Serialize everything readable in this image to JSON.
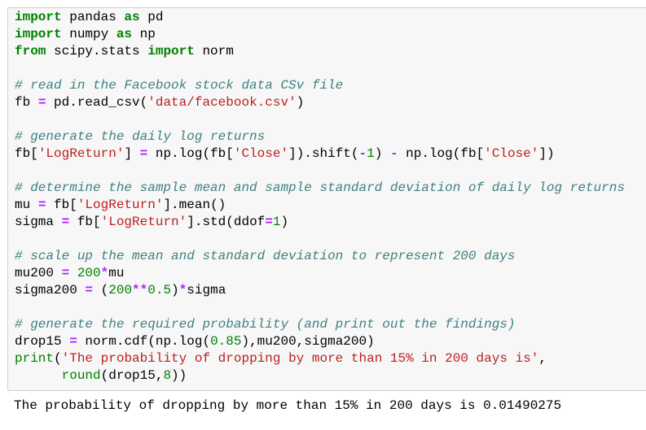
{
  "code_cell": {
    "lines": [
      [
        [
          "k",
          "import"
        ],
        [
          "t",
          " pandas "
        ],
        [
          "k",
          "as"
        ],
        [
          "t",
          " pd"
        ]
      ],
      [
        [
          "k",
          "import"
        ],
        [
          "t",
          " numpy "
        ],
        [
          "k",
          "as"
        ],
        [
          "t",
          " np"
        ]
      ],
      [
        [
          "k",
          "from"
        ],
        [
          "t",
          " scipy.stats "
        ],
        [
          "k",
          "import"
        ],
        [
          "t",
          " norm"
        ]
      ],
      [],
      [
        [
          "c",
          "# read in the Facebook stock data CSv file"
        ]
      ],
      [
        [
          "t",
          "fb "
        ],
        [
          "o",
          "="
        ],
        [
          "t",
          " pd.read_csv("
        ],
        [
          "s",
          "'data/facebook.csv'"
        ],
        [
          "t",
          ")"
        ]
      ],
      [],
      [
        [
          "c",
          "# generate the daily log returns"
        ]
      ],
      [
        [
          "t",
          "fb["
        ],
        [
          "s",
          "'LogReturn'"
        ],
        [
          "t",
          "] "
        ],
        [
          "o",
          "="
        ],
        [
          "t",
          " np.log(fb["
        ],
        [
          "s",
          "'Close'"
        ],
        [
          "t",
          "]).shift("
        ],
        [
          "o",
          "-"
        ],
        [
          "n",
          "1"
        ],
        [
          "t",
          ") "
        ],
        [
          "o",
          "-"
        ],
        [
          "t",
          " np.log(fb["
        ],
        [
          "s",
          "'Close'"
        ],
        [
          "t",
          "])"
        ]
      ],
      [],
      [
        [
          "c",
          "# determine the sample mean and sample standard deviation of daily log returns"
        ]
      ],
      [
        [
          "t",
          "mu "
        ],
        [
          "o",
          "="
        ],
        [
          "t",
          " fb["
        ],
        [
          "s",
          "'LogReturn'"
        ],
        [
          "t",
          "].mean()"
        ]
      ],
      [
        [
          "t",
          "sigma "
        ],
        [
          "o",
          "="
        ],
        [
          "t",
          " fb["
        ],
        [
          "s",
          "'LogReturn'"
        ],
        [
          "t",
          "].std(ddof"
        ],
        [
          "o",
          "="
        ],
        [
          "n",
          "1"
        ],
        [
          "t",
          ")"
        ]
      ],
      [],
      [
        [
          "c",
          "# scale up the mean and standard deviation to represent 200 days"
        ]
      ],
      [
        [
          "t",
          "mu200 "
        ],
        [
          "o",
          "="
        ],
        [
          "t",
          " "
        ],
        [
          "n",
          "200"
        ],
        [
          "o",
          "*"
        ],
        [
          "t",
          "mu"
        ]
      ],
      [
        [
          "t",
          "sigma200 "
        ],
        [
          "o",
          "="
        ],
        [
          "t",
          " ("
        ],
        [
          "n",
          "200"
        ],
        [
          "o",
          "**"
        ],
        [
          "n",
          "0.5"
        ],
        [
          "t",
          ")"
        ],
        [
          "o",
          "*"
        ],
        [
          "t",
          "sigma"
        ]
      ],
      [],
      [
        [
          "c",
          "# generate the required probability (and print out the findings)"
        ]
      ],
      [
        [
          "t",
          "drop15 "
        ],
        [
          "o",
          "="
        ],
        [
          "t",
          " norm.cdf(np.log("
        ],
        [
          "n",
          "0.85"
        ],
        [
          "t",
          "),mu200,sigma200)"
        ]
      ],
      [
        [
          "b",
          "print"
        ],
        [
          "t",
          "("
        ],
        [
          "s",
          "'The probability of dropping by more than 15% in 200 days is'"
        ],
        [
          "t",
          ","
        ]
      ],
      [
        [
          "t",
          "      "
        ],
        [
          "b",
          "round"
        ],
        [
          "t",
          "(drop15,"
        ],
        [
          "n",
          "8"
        ],
        [
          "t",
          "))"
        ]
      ]
    ]
  },
  "output": {
    "text": "The probability of dropping by more than 15% in 200 days is 0.01490275"
  },
  "colors": {
    "keyword": "#008000",
    "operator": "#AA22FF",
    "string": "#BA2121",
    "comment": "#408080",
    "number": "#008000",
    "cell_background": "#f7f7f7"
  }
}
